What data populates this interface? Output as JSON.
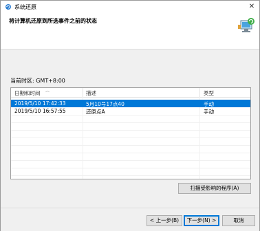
{
  "window": {
    "title": "系统还原"
  },
  "header": {
    "title": "将计算机还原到所选事件之前的状态"
  },
  "timezone": "当前时区: GMT+8:00",
  "table": {
    "columns": [
      "日期和时间",
      "描述",
      "类型"
    ],
    "rows": [
      {
        "date": "2019/5/10 17:42:33",
        "description": "5月10号17点40",
        "type": "手动",
        "selected": true
      },
      {
        "date": "2019/5/10 16:57:55",
        "description": "还原点A",
        "type": "手动",
        "selected": false
      }
    ]
  },
  "scan_button": "扫描受影响的程序(A)",
  "footer": {
    "back": "< 上一步(B)",
    "next": "下一步(N) >",
    "cancel": "取消"
  },
  "colors": {
    "selection": "#0078d7",
    "panel": "#f0f0f0"
  }
}
